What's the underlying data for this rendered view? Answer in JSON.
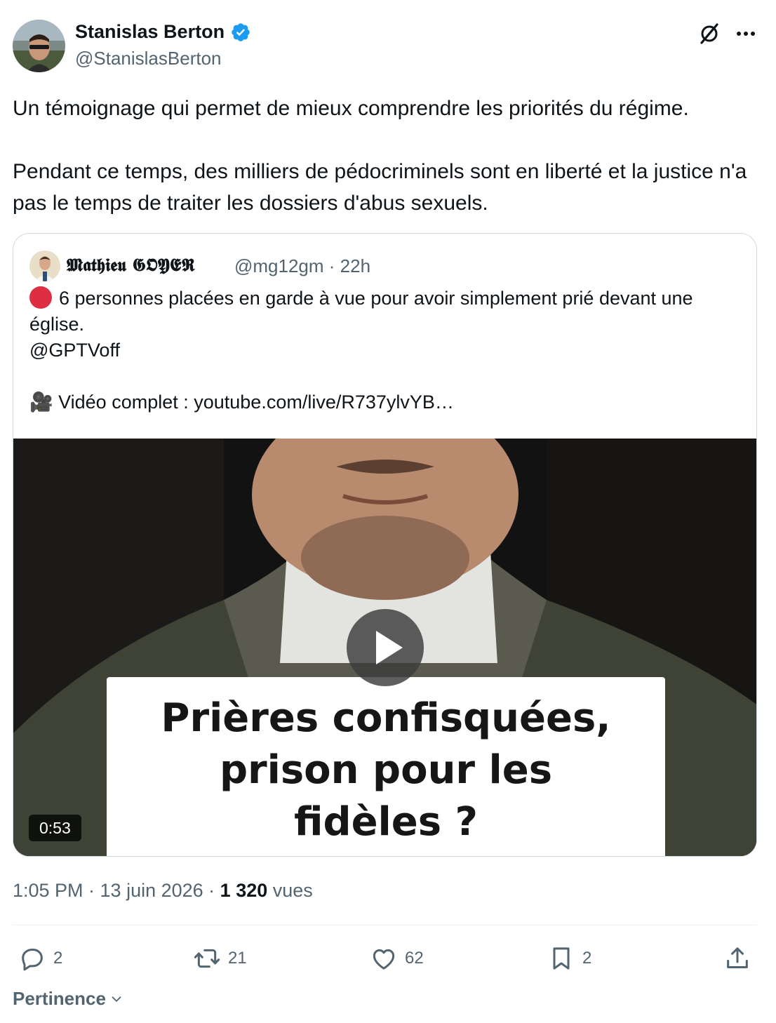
{
  "author": {
    "name": "Stanislas Berton",
    "handle": "@StanislasBerton",
    "verified": true
  },
  "tweet": {
    "text": "Un témoignage qui permet de mieux comprendre les priorités du régime.\n\nPendant ce temps, des milliers de pédocriminels sont en liberté et la justice n'a pas le temps de traiter les dossiers d'abus sexuels."
  },
  "quote": {
    "name": "𝕸𝖆𝖙𝖍𝖎𝖊𝖚 𝕲𝕺𝖄𝕰𝕽",
    "handle_time": "@mg12gm · 22h",
    "line1": "6 personnes placées en garde à vue pour avoir simplement prié devant une église.",
    "line2": "@GPTVoff",
    "line3": "🎥 Vidéo complet : youtube.com/live/R737ylvYB…",
    "video": {
      "caption": "Prières confisquées,\nprison pour les\nfidèles ?",
      "duration": "0:53"
    }
  },
  "meta": {
    "time_date": "1:05 PM · 13 juin 2026 · ",
    "views_count": "1 320",
    "views_label": " vues"
  },
  "actions": {
    "replies": "2",
    "reposts": "21",
    "likes": "62",
    "bookmarks": "2"
  },
  "sort": {
    "label": "Pertinence"
  },
  "colors": {
    "text": "#0f1419",
    "secondary": "#536471",
    "verified": "#1d9bf0",
    "border": "#cfd9de"
  },
  "icons": [
    "grok-icon",
    "more-icon",
    "verified-icon",
    "reply-icon",
    "repost-icon",
    "like-icon",
    "bookmark-icon",
    "share-icon",
    "chevron-down-icon",
    "play-icon",
    "red-circle-icon",
    "camera-icon"
  ]
}
